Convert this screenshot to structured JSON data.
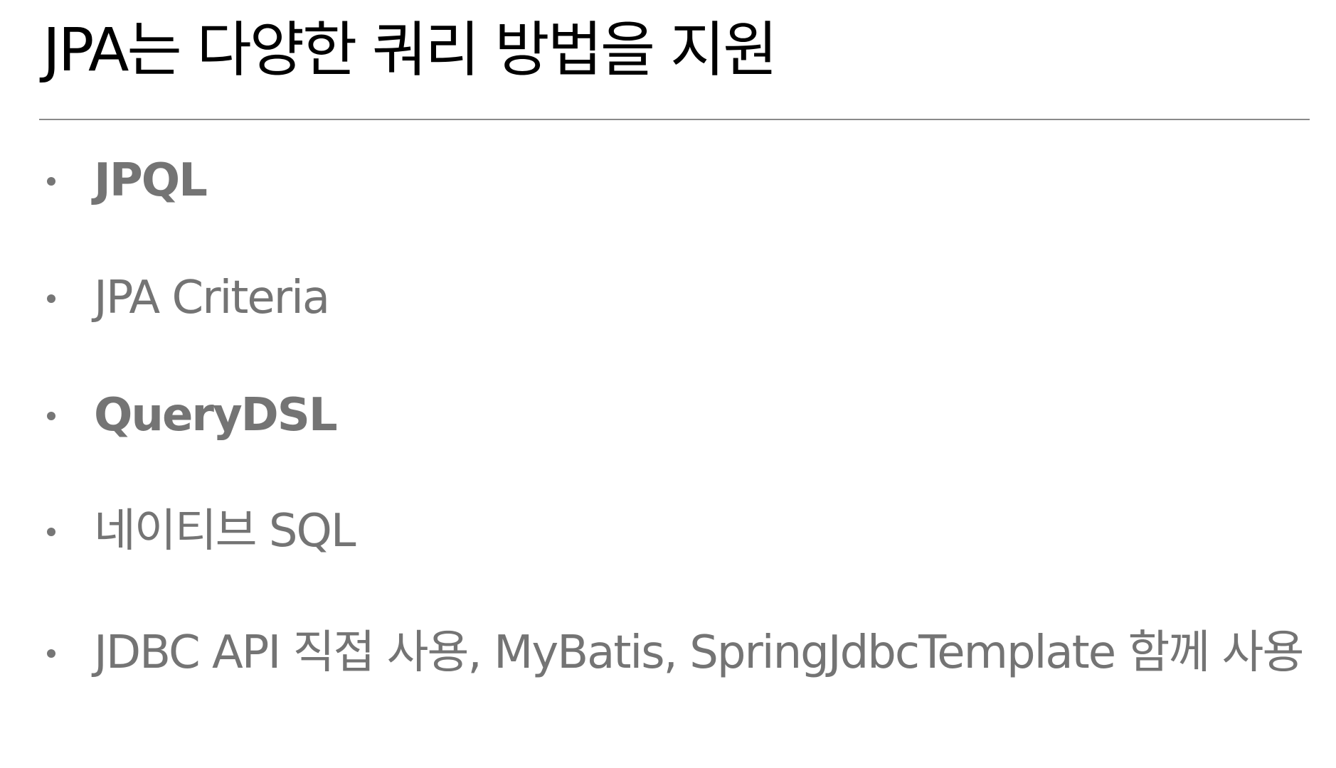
{
  "slide": {
    "title": "JPA는 다양한 쿼리 방법을 지원",
    "bullets": [
      {
        "text": "JPQL",
        "bold": true
      },
      {
        "text": "JPA Criteria",
        "bold": false
      },
      {
        "text": "QueryDSL",
        "bold": true
      },
      {
        "text": "네이티브 SQL",
        "bold": false
      },
      {
        "text": "JDBC API 직접 사용, MyBatis, SpringJdbcTemplate 함께 사용",
        "bold": false
      }
    ]
  },
  "colors": {
    "background": "#ffffff",
    "title": "#000000",
    "bullet_text": "#747474",
    "divider": "#8a8a8a"
  }
}
